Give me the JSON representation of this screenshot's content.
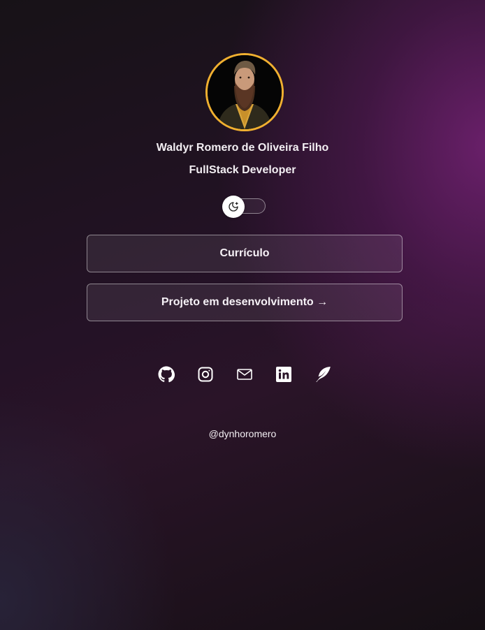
{
  "profile": {
    "name": "Waldyr Romero de Oliveira Filho",
    "role": "FullStack Developer",
    "avatar_alt": "profile photo",
    "avatar_ring_color": "#f0b030"
  },
  "theme_toggle": {
    "icon": "moon-star-icon",
    "state": "dark"
  },
  "links": [
    {
      "label": "Currículo"
    },
    {
      "label": "Projeto em desenvolvimento →"
    }
  ],
  "socials": [
    {
      "icon": "github-icon"
    },
    {
      "icon": "instagram-icon"
    },
    {
      "icon": "mail-icon"
    },
    {
      "icon": "linkedin-icon"
    },
    {
      "icon": "feather-icon"
    }
  ],
  "footer": {
    "handle": "@dynhoromero"
  },
  "colors": {
    "background_dark": "#171217",
    "accent_purple": "#5a1a5c",
    "text": "#f2eef2"
  }
}
